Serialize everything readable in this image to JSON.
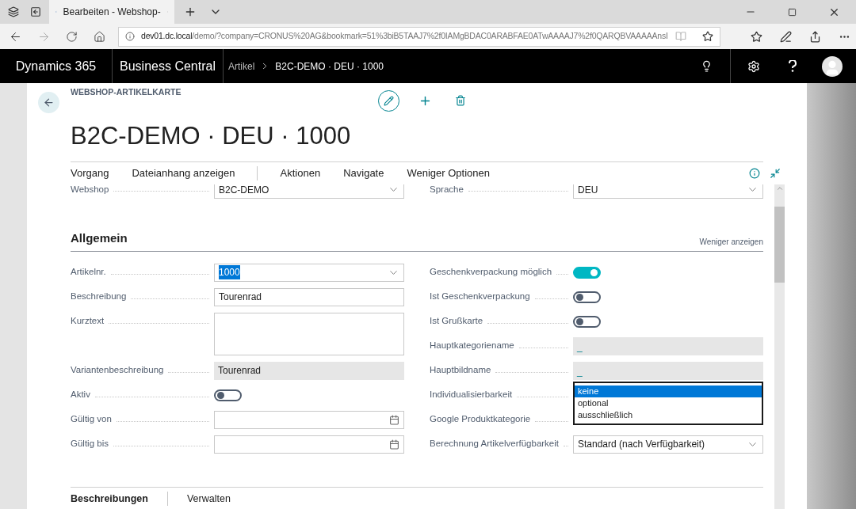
{
  "browser": {
    "tab": {
      "title": "Bearbeiten - Webshop-",
      "selected": true
    },
    "address": {
      "host": "dev01.dc.local",
      "path": "/demo/?company=CRONUS%20AG&bookmark=51%3biB5TAAJ7%2f0IAMgBDAC0ARABFAE0ATwAAAAJ7%2f0QARQBVAAAAAnsI"
    }
  },
  "app_bar": {
    "product": "Dynamics 365",
    "app": "Business Central",
    "breadcrumb": [
      "Artikel",
      "B2C-DEMO · DEU · 1000"
    ]
  },
  "page": {
    "caption": "WEBSHOP-ARTIKELKARTE",
    "title": "B2C-DEMO · DEU · 1000",
    "actions": [
      "Vorgang",
      "Dateianhang anzeigen",
      "Aktionen",
      "Navigate",
      "Weniger Optionen"
    ],
    "top_fields": [
      {
        "label": "Webshop",
        "kind": "dropdown",
        "value": "B2C-DEMO"
      },
      {
        "label": "Sprache",
        "kind": "dropdown",
        "value": "DEU"
      }
    ],
    "section": {
      "title": "Allgemein",
      "toggle_label": "Weniger anzeigen",
      "left_fields": [
        {
          "label": "Artikelnr.",
          "kind": "dropdown",
          "value": "1000",
          "highlighted": true
        },
        {
          "label": "Beschreibung",
          "kind": "text",
          "value": "Tourenrad"
        },
        {
          "label": "Kurztext",
          "kind": "textarea"
        },
        {
          "label": "Variantenbeschreibung",
          "kind": "readonly",
          "value": "Tourenrad"
        },
        {
          "label": "Aktiv",
          "kind": "toggle",
          "on": false
        },
        {
          "label": "Gültig von",
          "kind": "date"
        },
        {
          "label": "Gültig bis",
          "kind": "date"
        }
      ],
      "right_fields": [
        {
          "label": "Geschenkverpackung möglich",
          "kind": "toggle",
          "on": true
        },
        {
          "label": "Ist Geschenkverpackung",
          "kind": "toggle",
          "on": false
        },
        {
          "label": "Ist Grußkarte",
          "kind": "toggle",
          "on": false
        },
        {
          "label": "Hauptkategoriename",
          "kind": "lookup",
          "value": "_"
        },
        {
          "label": "Hauptbildname",
          "kind": "lookup",
          "value": "_"
        },
        {
          "label": "Individualisierbarkeit",
          "kind": "listbox",
          "options": [
            {
              "label": "keine",
              "selected": true
            },
            {
              "label": "optional",
              "selected": false
            },
            {
              "label": "ausschließlich",
              "selected": false
            }
          ]
        },
        {
          "label": "Google Produktkategorie",
          "kind": "covered"
        },
        {
          "label": "Berechnung Artikelverfügbarkeit",
          "kind": "dropdown",
          "value": "Standard (nach Verfügbarkeit)"
        }
      ]
    },
    "bottom_tabs": [
      {
        "label": "Beschreibungen",
        "selected": true
      },
      {
        "label": "Verwalten",
        "selected": false
      }
    ]
  }
}
